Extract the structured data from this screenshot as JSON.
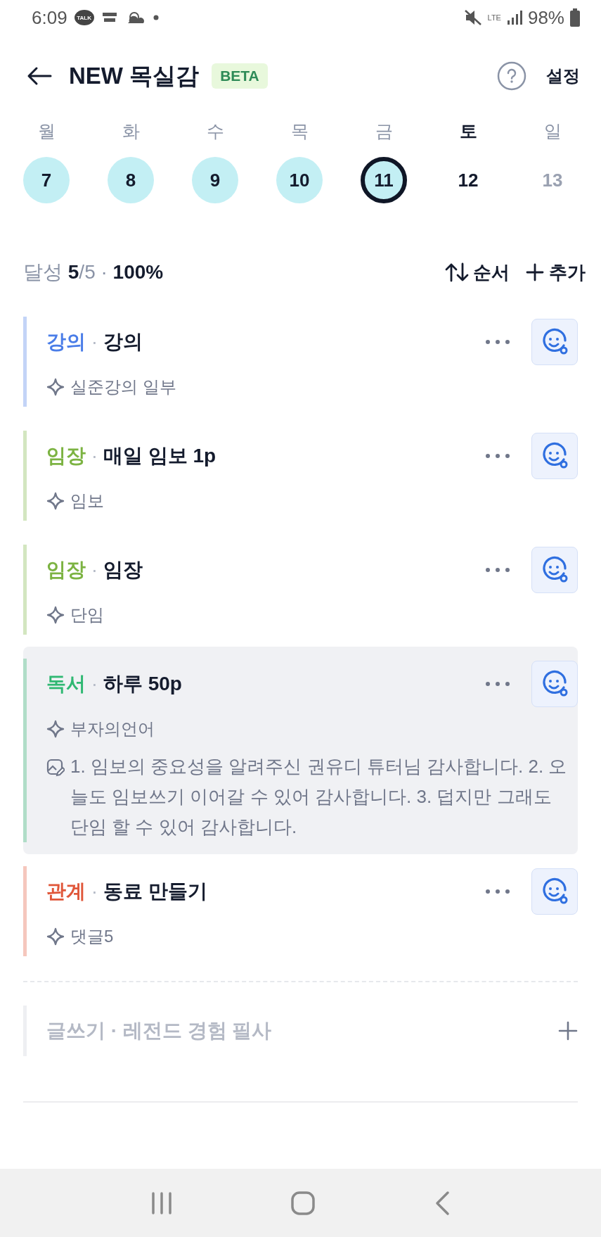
{
  "status_bar": {
    "time": "6:09",
    "talk_badge": "TALK",
    "network": "LTE",
    "battery": "98%"
  },
  "header": {
    "title": "NEW 목실감",
    "badge": "BETA",
    "settings": "설정"
  },
  "week": [
    {
      "weekday": "월",
      "date": "7",
      "done": true,
      "selected": false,
      "muted": false,
      "emphasized": false
    },
    {
      "weekday": "화",
      "date": "8",
      "done": true,
      "selected": false,
      "muted": false,
      "emphasized": false
    },
    {
      "weekday": "수",
      "date": "9",
      "done": true,
      "selected": false,
      "muted": false,
      "emphasized": false
    },
    {
      "weekday": "목",
      "date": "10",
      "done": true,
      "selected": false,
      "muted": false,
      "emphasized": false
    },
    {
      "weekday": "금",
      "date": "11",
      "done": true,
      "selected": true,
      "muted": false,
      "emphasized": false
    },
    {
      "weekday": "토",
      "date": "12",
      "done": false,
      "selected": false,
      "muted": false,
      "emphasized": true
    },
    {
      "weekday": "일",
      "date": "13",
      "done": false,
      "selected": false,
      "muted": true,
      "emphasized": false
    }
  ],
  "summary": {
    "label": "달성",
    "done": "5",
    "total": "/5",
    "separator": "·",
    "percent": "100%"
  },
  "actions": [
    {
      "kind": "sort",
      "label": "순서"
    },
    {
      "kind": "add",
      "label": "추가"
    }
  ],
  "goals": [
    {
      "category": "강의",
      "color": "#4a7de8",
      "separator": "·",
      "title": "강의",
      "subtitle": "실준강의 일부",
      "selected": false
    },
    {
      "category": "임장",
      "color": "#7cb342",
      "separator": "·",
      "title": "매일 임보 1p",
      "subtitle": "임보",
      "selected": false
    },
    {
      "category": "임장",
      "color": "#7cb342",
      "separator": "·",
      "title": "임장",
      "subtitle": "단임",
      "selected": false
    },
    {
      "category": "독서",
      "color": "#2fb872",
      "separator": "·",
      "title": "하루 50p",
      "subtitle": "부자의언어",
      "note": "1. 임보의 중요성을 알려주신 권유디 튜터님 감사합니다. 2. 오늘도 임보쓰기 이어갈 수 있어 감사합니다. 3. 덥지만 그래도 단임 할 수 있어 감사합니다.",
      "selected": true
    },
    {
      "category": "관계",
      "color": "#e0573a",
      "separator": "·",
      "title": "동료 만들기",
      "subtitle": "댓글5",
      "selected": false
    }
  ],
  "suggestion": {
    "text": "글쓰기 · 레전드 경험 필사"
  }
}
